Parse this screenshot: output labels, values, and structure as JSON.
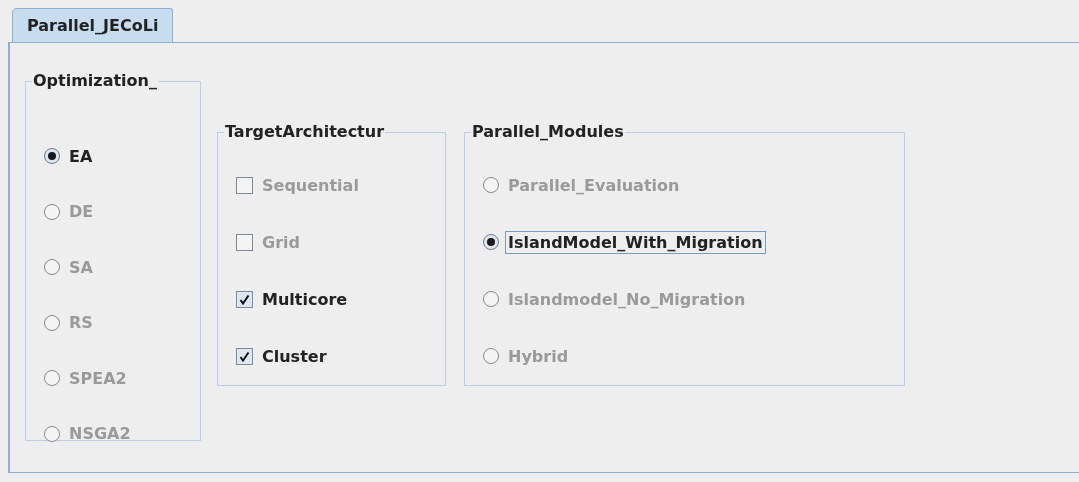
{
  "tabs": [
    {
      "label": "Parallel_JECoLi",
      "selected": true
    }
  ],
  "groups": [
    {
      "title": "Optimization_",
      "items": [
        {
          "kind": "radio",
          "label": "EA",
          "selected": true,
          "disabled": false
        },
        {
          "kind": "radio",
          "label": "DE",
          "selected": false,
          "disabled": true
        },
        {
          "kind": "radio",
          "label": "SA",
          "selected": false,
          "disabled": true
        },
        {
          "kind": "radio",
          "label": "RS",
          "selected": false,
          "disabled": true
        },
        {
          "kind": "radio",
          "label": "SPEA2",
          "selected": false,
          "disabled": true
        },
        {
          "kind": "radio",
          "label": "NSGA2",
          "selected": false,
          "disabled": true
        }
      ]
    },
    {
      "title": "TargetArchitectur",
      "items": [
        {
          "kind": "checkbox",
          "label": "Sequential",
          "checked": false,
          "disabled": true
        },
        {
          "kind": "checkbox",
          "label": "Grid",
          "checked": false,
          "disabled": true
        },
        {
          "kind": "checkbox",
          "label": "Multicore",
          "checked": true,
          "disabled": false
        },
        {
          "kind": "checkbox",
          "label": "Cluster",
          "checked": true,
          "disabled": false
        }
      ]
    },
    {
      "title": "Parallel_Modules",
      "items": [
        {
          "kind": "radio",
          "label": "Parallel_Evaluation",
          "selected": false,
          "disabled": true,
          "focused": false
        },
        {
          "kind": "radio",
          "label": "IslandModel_With_Migration",
          "selected": true,
          "disabled": false,
          "focused": true
        },
        {
          "kind": "radio",
          "label": "Islandmodel_No_Migration",
          "selected": false,
          "disabled": true,
          "focused": false
        },
        {
          "kind": "radio",
          "label": "Hybrid",
          "selected": false,
          "disabled": true,
          "focused": false
        }
      ]
    }
  ]
}
